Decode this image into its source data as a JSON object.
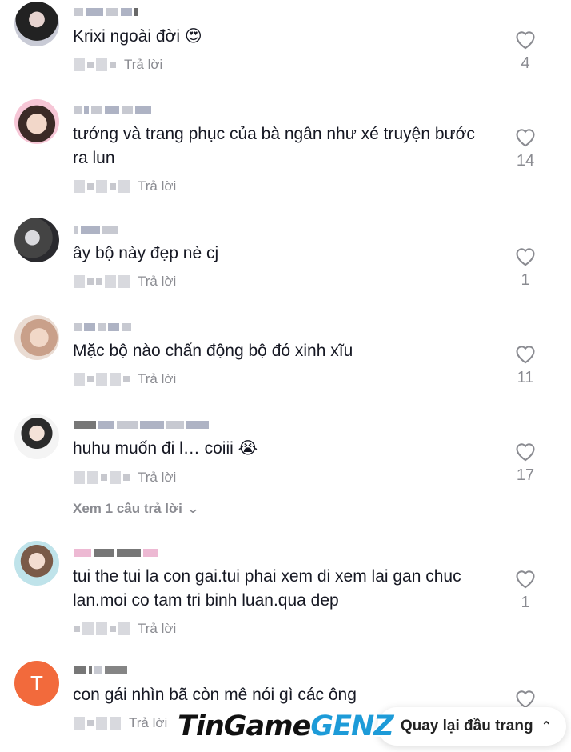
{
  "comments": [
    {
      "text": "Krixi ngoài đời 😍",
      "likes": "4"
    },
    {
      "text": "tướng và trang phục của bà ngân như xé truyện bước ra lun",
      "likes": "14"
    },
    {
      "text": "ây bộ này đẹp nè cj",
      "likes": "1"
    },
    {
      "text": "Mặc bộ nào chấn động bộ đó xinh xĩu",
      "likes": "11"
    },
    {
      "text": "huhu muốn đi l… coiii 😭",
      "likes": "17"
    },
    {
      "text": "tui the tui la con gai.tui phai xem di xem lai gan chuc lan.moi co tam tri binh luan.qua dep",
      "likes": "1"
    },
    {
      "text": "con gái nhìn bã còn mê nói gì các ông",
      "likes": ""
    }
  ],
  "reply_label": "Trả lời",
  "view_replies": "Xem 1 câu trả lời",
  "last_avatar_initial": "T",
  "watermark": {
    "part1": "TinGame",
    "part2": "GENZ"
  },
  "back_to_top": "Quay lại đầu trang",
  "colors": {
    "text": "#161823",
    "muted": "#8a8b91",
    "avatar_t": "#f26a3c",
    "brand_blue": "#1d9bd8"
  }
}
